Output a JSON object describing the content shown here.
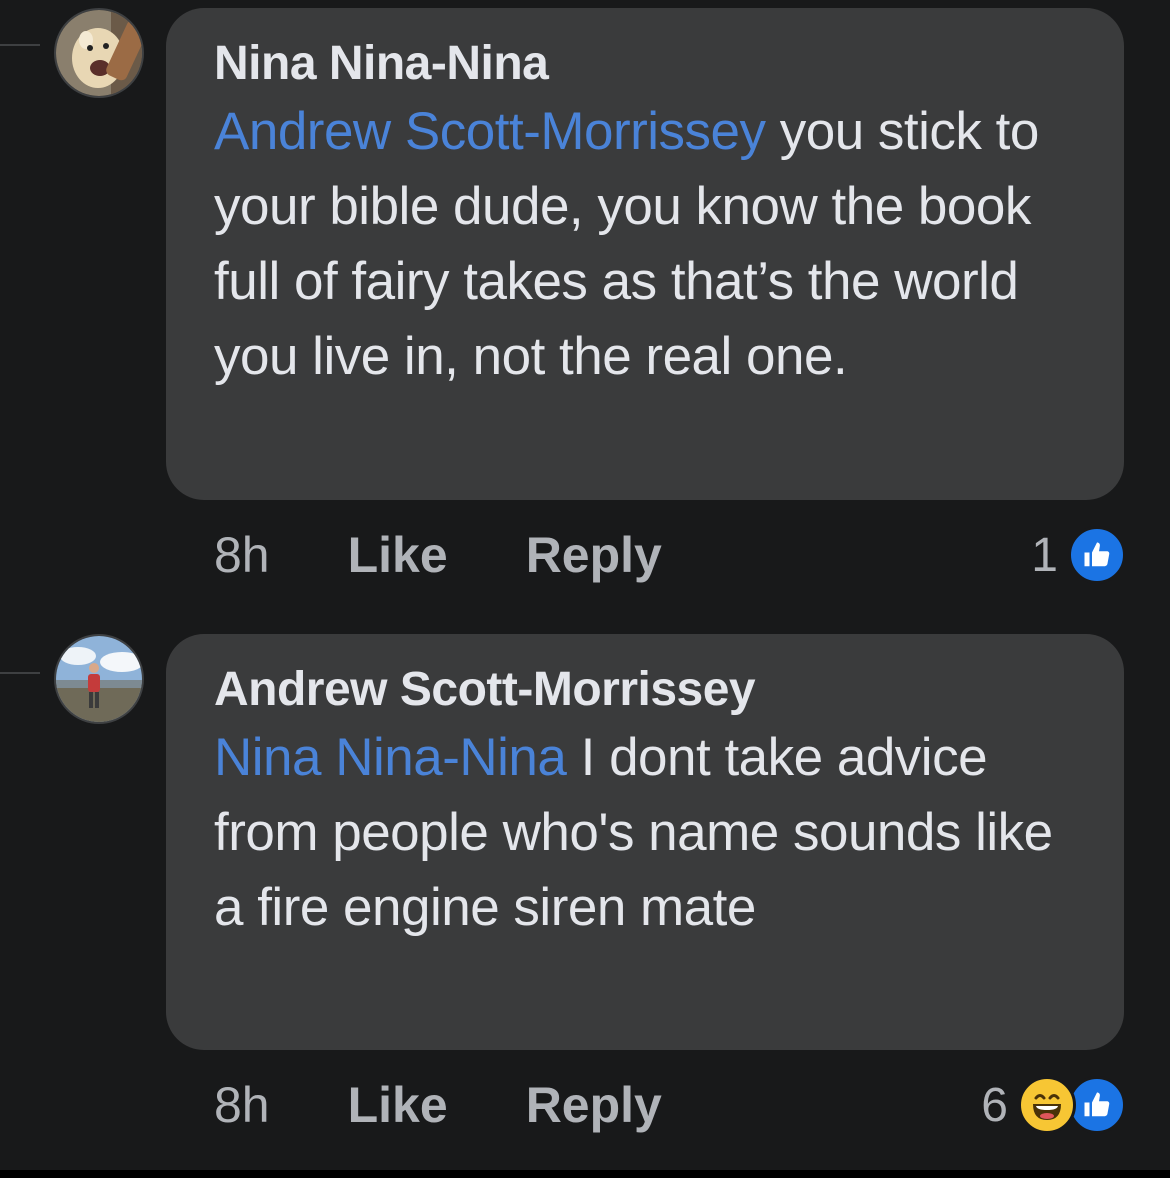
{
  "comments": [
    {
      "author": "Nina Nina-Nina",
      "mention": "Andrew Scott-Morrissey",
      "text": " you stick to your bible dude, you know the book full of fairy takes as that’s the world you live in, not the real one.",
      "time": "8h",
      "like_label": "Like",
      "reply_label": "Reply",
      "reaction_count": "1",
      "reactions": [
        "like-icon"
      ]
    },
    {
      "author": "Andrew Scott-Morrissey",
      "mention": "Nina Nina-Nina",
      "text": " I dont take advice from people who's name sounds like a fire engine siren mate",
      "time": "8h",
      "like_label": "Like",
      "reply_label": "Reply",
      "reaction_count": "6",
      "reactions": [
        "haha-icon",
        "like-icon"
      ]
    }
  ],
  "colors": {
    "background": "#18191a",
    "bubble": "#3a3b3c",
    "mention": "#4a83d8",
    "like_blue": "#1b74e4",
    "meta_text": "#b0b3b8"
  }
}
